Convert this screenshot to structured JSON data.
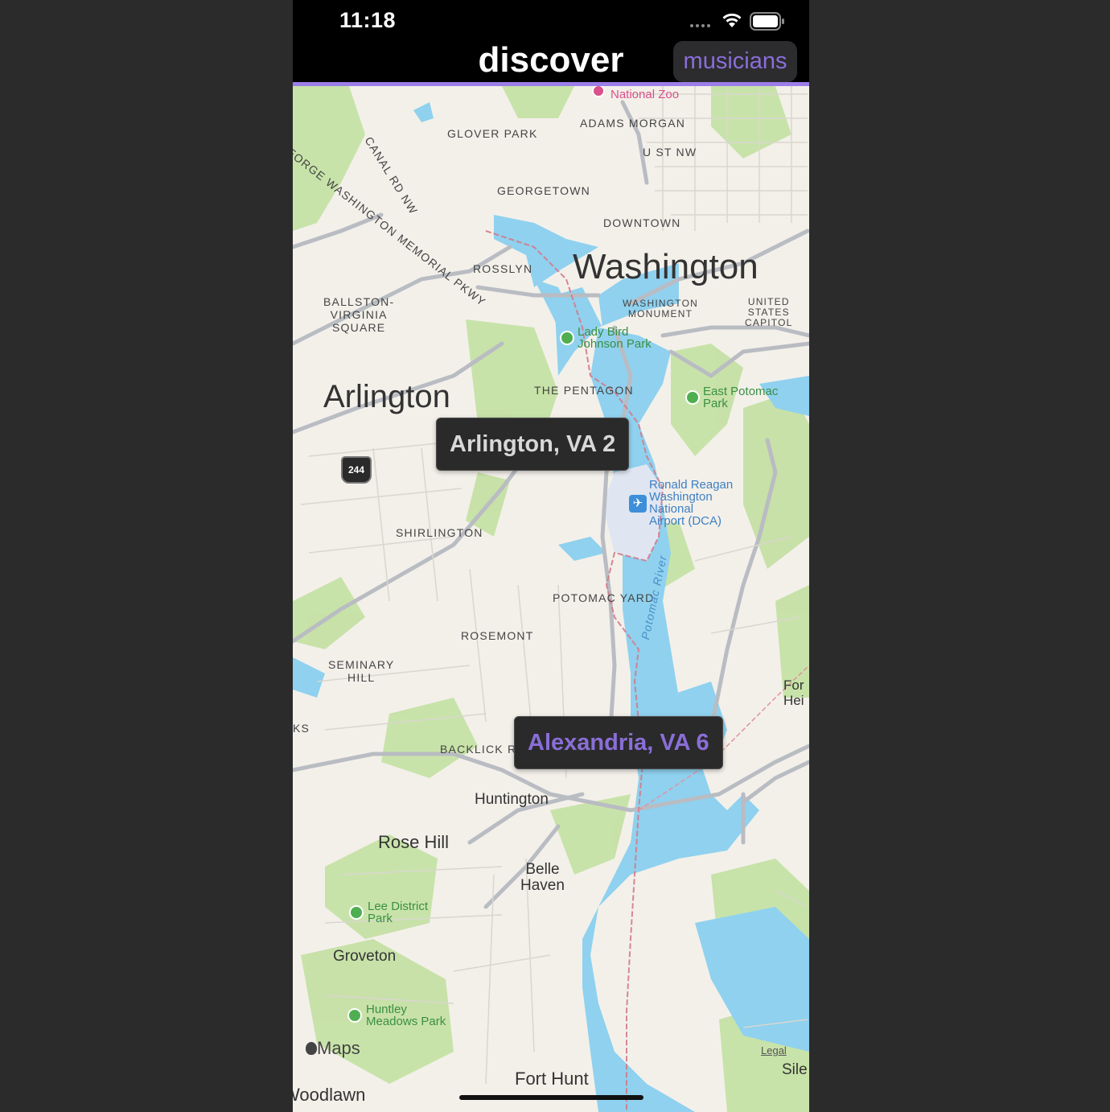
{
  "status_bar": {
    "time": "11:18"
  },
  "nav": {
    "title": "discover",
    "button_label": "musicians"
  },
  "colors": {
    "accent": "#9b7ee8",
    "button_text": "#8a6ed8",
    "pin_bg": "#2a2a2a",
    "pin_text_default": "#d8d8d8"
  },
  "pins": [
    {
      "label": "Arlington, VA 2",
      "selected": false
    },
    {
      "label": "Alexandria, VA 6",
      "selected": true
    }
  ],
  "map": {
    "cities": [
      "Washington",
      "Arlington"
    ],
    "neighborhoods": [
      "GLOVER PARK",
      "ADAMS MORGAN",
      "U ST NW",
      "GEORGETOWN",
      "DOWNTOWN",
      "ROSSLYN",
      "BALLSTON-\nVIRGINIA\nSQUARE",
      "WASHINGTON\nMONUMENT",
      "UNITED\nSTATES\nCAPITOL",
      "THE PENTAGON",
      "SHIRLINGTON",
      "POTOMAC YARD",
      "ROSEMONT",
      "SEMINARY\nHILL",
      "BACKLICK RU",
      "KS"
    ],
    "places": [
      "Huntington",
      "Rose Hill",
      "Belle\nHaven",
      "Groveton",
      "Fort Hunt",
      "Woodlawn",
      "For\nHei",
      "Sile"
    ],
    "parks": [
      "Lady Bird\nJohnson Park",
      "East Potomac\nPark",
      "Lee District\nPark",
      "Huntley\nMeadows Park"
    ],
    "poi": {
      "zoo": "National Zoo",
      "airport": "Ronald Reagan\nWashington\nNational\nAirport (DCA)"
    },
    "river": "Potomac River",
    "roads": {
      "gw_parkway": "GEORGE WASHINGTON MEMORIAL PKWY",
      "canal_rd": "CANAL RD NW",
      "shield": "244"
    },
    "attribution": {
      "logo": "Maps",
      "legal": "Legal"
    }
  }
}
